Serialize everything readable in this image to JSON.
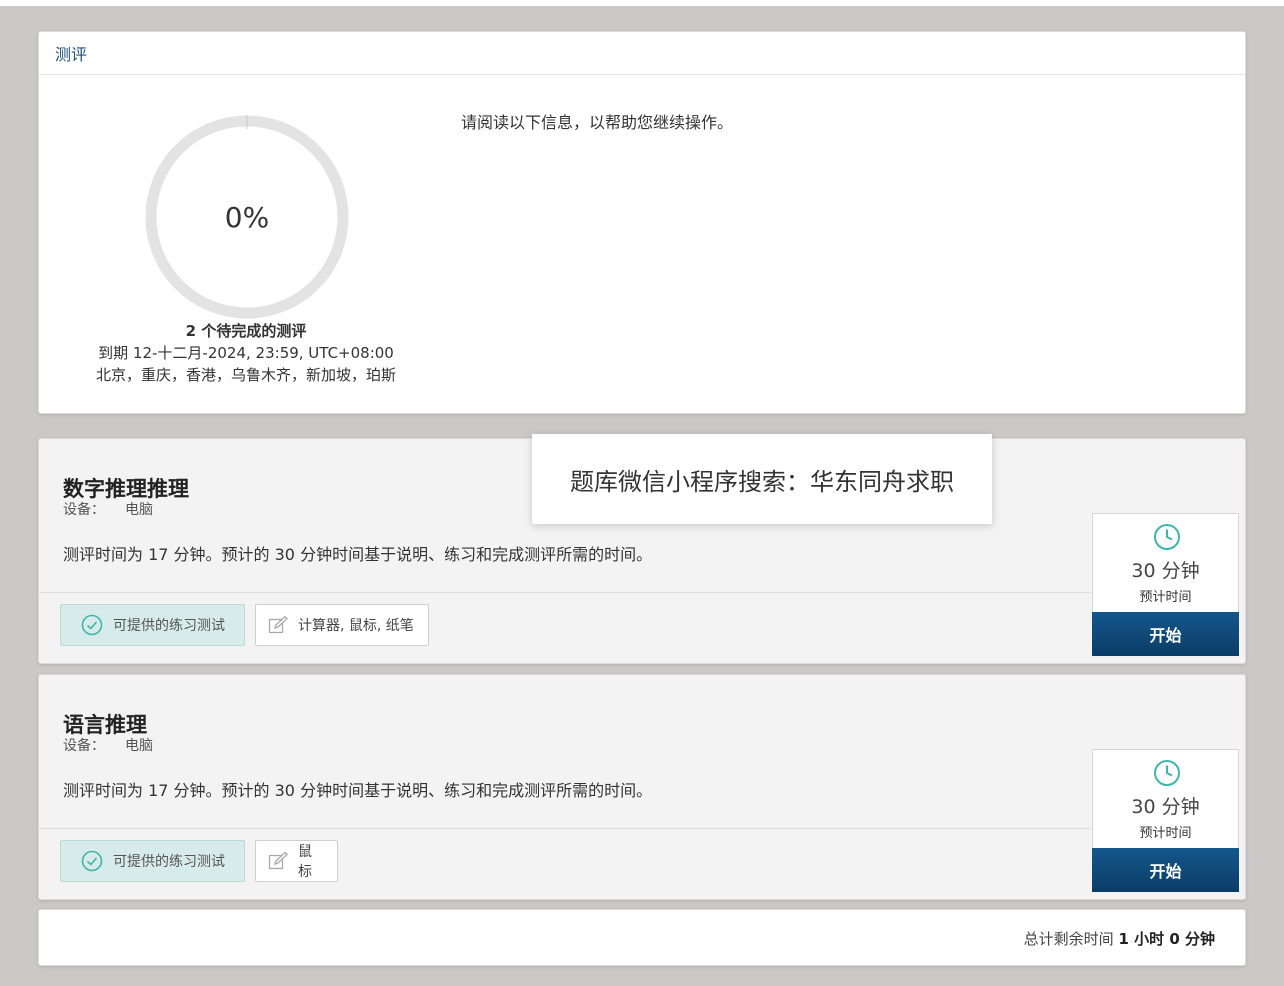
{
  "overview": {
    "header": "测评",
    "progress_percent_text": "0%",
    "progress_fraction": 0,
    "pending_count": "2",
    "pending_label": "个待完成的测评",
    "due_text": "到期 12-十二月-2024, 23:59, UTC+08:00",
    "timezone_cities": "北京，重庆，香港，乌鲁木齐，新加坡，珀斯",
    "instruction": "请阅读以下信息，以帮助您继续操作。"
  },
  "assessments": [
    {
      "title": "数字推理推理",
      "device_label": "设备：",
      "device_value": "电脑",
      "description": "测评时间为 17 分钟。预计的 30 分钟时间基于说明、练习和完成测评所需的时间。",
      "practice_label": "可提供的练习测试",
      "tools_label": "计算器, 鼠标, 纸笔",
      "minutes": "30 分钟",
      "estimate_label": "预计时间",
      "start_label": "开始"
    },
    {
      "title": "语言推理",
      "device_label": "设备：",
      "device_value": "电脑",
      "description": "测评时间为 17 分钟。预计的 30 分钟时间基于说明、练习和完成测评所需的时间。",
      "practice_label": "可提供的练习测试",
      "tools_label": "鼠标",
      "minutes": "30 分钟",
      "estimate_label": "预计时间",
      "start_label": "开始"
    }
  ],
  "footer": {
    "remaining_label": "总计剩余时间",
    "remaining_value": "1 小时 0 分钟"
  },
  "overlay_text": "题库微信小程序搜索：华东同舟求职",
  "colors": {
    "page_bg": "#cbc8c8",
    "accent_teal": "#3fb5a8",
    "start_button": "#0f4a7a",
    "header_text": "#1f4e79"
  },
  "icons": [
    "clock-icon",
    "check-circle-icon",
    "edit-icon"
  ]
}
